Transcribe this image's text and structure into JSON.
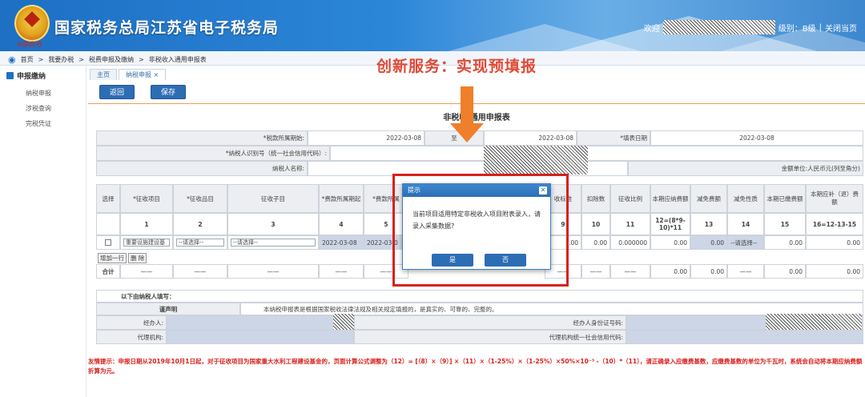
{
  "header": {
    "site_title": "国家税务总局江苏省电子税务局",
    "logo_script": "中国税务",
    "welcome": "欢迎",
    "level": "级别：B级",
    "close_page": "关闭当页"
  },
  "breadcrumb": [
    "首页",
    ">",
    "我要办税",
    ">",
    "税费申报及缴纳",
    ">",
    "非税收入通用申报表"
  ],
  "promo_text": "创新服务：实现预填报",
  "sidebar": {
    "title": "申报缴纳",
    "items": [
      "纳税申报",
      "涉税查询",
      "完税凭证"
    ]
  },
  "tabs": [
    {
      "label": "主页",
      "active": false
    },
    {
      "label": "纳税申报 ×",
      "active": true
    }
  ],
  "toolbar": {
    "back": "返回",
    "save": "保存"
  },
  "form": {
    "title": "非税收 通用申报表",
    "period_label": "*税款所属期始:",
    "period_start": "2022-03-08",
    "period_to": "至",
    "period_end": "2022-03-08",
    "fill_date_label": "*填表日期",
    "fill_date": "2022-03-08",
    "taxpayer_id_label": "*纳税人识别号（统一社会信用代码）:",
    "taxpayer_name_label": "纳税人名称:",
    "unit": "金额单位:人民币元(列至角分)"
  },
  "table": {
    "headers": [
      "选择",
      "*征收项目",
      "*征收品目",
      "征收子目",
      "*费款所属期起",
      "*费款所属",
      "",
      "",
      "收标准",
      "扣除数",
      "征收比例",
      "本期应纳费额",
      "减免费额",
      "减免性质",
      "本期已缴费额",
      "本期应补（退）费额"
    ],
    "numbers": [
      "",
      "1",
      "2",
      "3",
      "4",
      "5",
      "",
      "",
      "9",
      "10",
      "11",
      "12=(8*9-10)*11",
      "13",
      "14",
      "15",
      "16=12-13-15"
    ],
    "row": {
      "item": "重要设施建设基",
      "subitem": "--请选择--",
      "sub2": "--请选择--",
      "date1": "2022-03-08",
      "date2": "2022-03-0",
      "c9": ".00",
      "c10": "0.00",
      "c11": "0.000000",
      "c12": "0.00",
      "c13": "0.00",
      "c14": "--请选择--",
      "c15": "0.00",
      "c16": "0.00"
    },
    "add_row": "增加一行",
    "delete_row": "删 除",
    "total_label": "合计",
    "dash": "——",
    "totals": [
      "0.00",
      "0.00",
      "0.00",
      "0.00"
    ]
  },
  "declaration": {
    "title": "以下由纳税人填写：",
    "statement_label": "谨声明",
    "statement": "本纳税申报表是根据国家税收法律法规及相关规定填报的，是真实的、可靠的、完整的。",
    "agent_label": "经办人:",
    "agent_id_label": "经办人身份证号码:",
    "agency_label": "代理机构:",
    "agency_code_label": "代理机构统一社会信用代码:"
  },
  "dialog": {
    "title": "提示",
    "message": "当前项目适用特定非税收入项目附表录入，请录入采集数据?",
    "yes": "是",
    "no": "否"
  },
  "notice": "友情提示：申报日期从2019年10月1日起，对于征收项目为国家重大水利工程建设基金的，页面计算公式调整为（12）= [（8）×（9）] ×（11）×（1-25%）×（1-25%）×50%×10⁻³ -（10）*（11），请正确录入应缴费基数，应缴费基数的单位为千瓦时，系统会自动将本期应纳费额折算为元。",
  "colors": {
    "brand_blue": "#2c86d8",
    "button_blue": "#2d6db4",
    "alert_red": "#d9201d",
    "arrow_orange": "#ef7f2a"
  }
}
